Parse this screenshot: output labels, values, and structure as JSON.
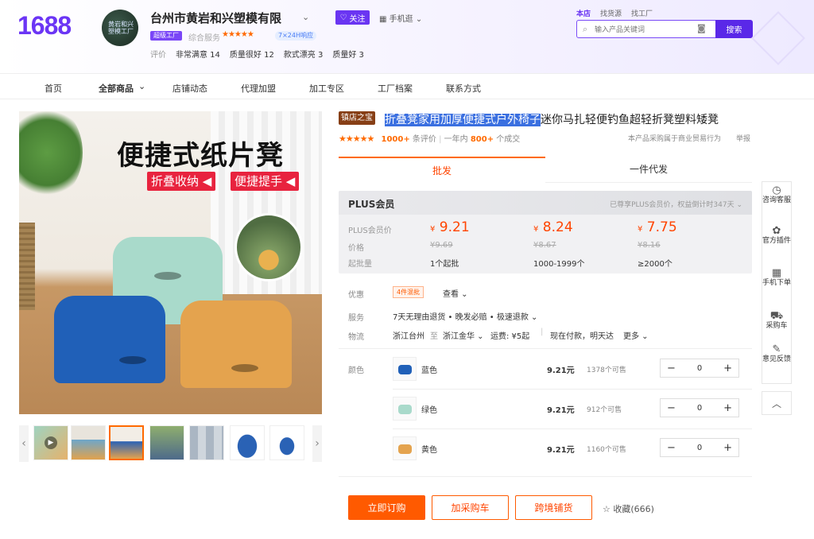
{
  "header": {
    "logo": "1688",
    "avatar_text": "黄岩和兴塑模工厂",
    "shop_name": "台州市黄岩和兴塑模有限",
    "follow_label": "关注",
    "mobile_shop_label": "手机逛",
    "factory_badge": "超级工厂",
    "rating_label": "综合服务",
    "stars": "★★★★★",
    "response_badge": "7×24H响应",
    "reviews": [
      {
        "label": "评价",
        "text": ""
      },
      {
        "label": "",
        "text": "非常满意 14"
      },
      {
        "label": "",
        "text": "质量很好 12"
      },
      {
        "label": "",
        "text": "款式漂亮 3"
      },
      {
        "label": "",
        "text": "质量好 3"
      }
    ],
    "search": {
      "tabs": [
        "本店",
        "找货源",
        "找工厂"
      ],
      "placeholder": "输入产品关键词",
      "button": "搜索"
    }
  },
  "nav": [
    "首页",
    "全部商品",
    "店铺动态",
    "代理加盟",
    "加工专区",
    "工厂档案",
    "联系方式"
  ],
  "product_image": {
    "title": "便捷式纸片凳",
    "tag1": "折叠收纳 ◀",
    "tag2": "便捷提手 ◀"
  },
  "product": {
    "store_badge": "镇店之宝",
    "title_highlight": "折叠凳家用加厚便捷式户外椅子",
    "title_rest": "迷你马扎轻便钓鱼超轻折凳塑料矮凳",
    "stars": "★★★★★",
    "review_count": "1000+",
    "review_suffix": "条评价",
    "sales_prefix": "一年内",
    "sales_count": "800+",
    "sales_suffix": "个成交",
    "trade_note": "本产品采购属于商业贸易行为",
    "report": "举报"
  },
  "tabs": [
    "批发",
    "一件代发"
  ],
  "plus": {
    "title": "PLUS会员",
    "note": "已尊享PLUS会员价，权益倒计时347天 ⌄",
    "labels": [
      "PLUS会员价",
      "价格",
      "起批量"
    ],
    "tiers": [
      {
        "currency": "¥",
        "plus_price": "9.21",
        "price": "¥9.69",
        "qty": "1个起批"
      },
      {
        "currency": "¥",
        "plus_price": "8.24",
        "price": "¥8.67",
        "qty": "1000-1999个"
      },
      {
        "currency": "¥",
        "plus_price": "7.75",
        "price": "¥8.16",
        "qty": "≥2000个"
      }
    ]
  },
  "details": {
    "promo_label": "优惠",
    "promo_tag": "4件混批",
    "promo_view": "查看 ⌄",
    "service_label": "服务",
    "service_value": "7天无理由退货 • 晚发必赔 • 极速退款 ⌄",
    "logistics_label": "物流",
    "from": "浙江台州",
    "to_word": "至",
    "to": "浙江金华 ⌄",
    "freight": "运费: ¥5起",
    "delivery": "现在付款，明天达",
    "more": "更多 ⌄",
    "color_label": "颜色"
  },
  "variants": [
    {
      "name": "蓝色",
      "price": "9.21元",
      "stock": "1378个可售",
      "qty": "0",
      "color": "#2060b8"
    },
    {
      "name": "绿色",
      "price": "9.21元",
      "stock": "912个可售",
      "qty": "0",
      "color": "#a9dacb"
    },
    {
      "name": "黄色",
      "price": "9.21元",
      "stock": "1160个可售",
      "qty": "0",
      "color": "#e4a34e"
    }
  ],
  "actions": {
    "order": "立即订购",
    "cart": "加采购车",
    "cross": "跨境铺货",
    "favorite": "☆ 收藏(666)"
  },
  "sidebar": [
    {
      "icon": "◷",
      "label": "咨询客服"
    },
    {
      "icon": "✿",
      "label": "官方插件"
    },
    {
      "icon": "▦",
      "label": "手机下单"
    },
    {
      "icon": "⛟",
      "label": "采购车"
    },
    {
      "icon": "✎",
      "label": "意见反馈"
    }
  ],
  "sidebar_top": "︿",
  "colors": {
    "brand": "#6b35f5",
    "accent": "#ff5a00"
  }
}
